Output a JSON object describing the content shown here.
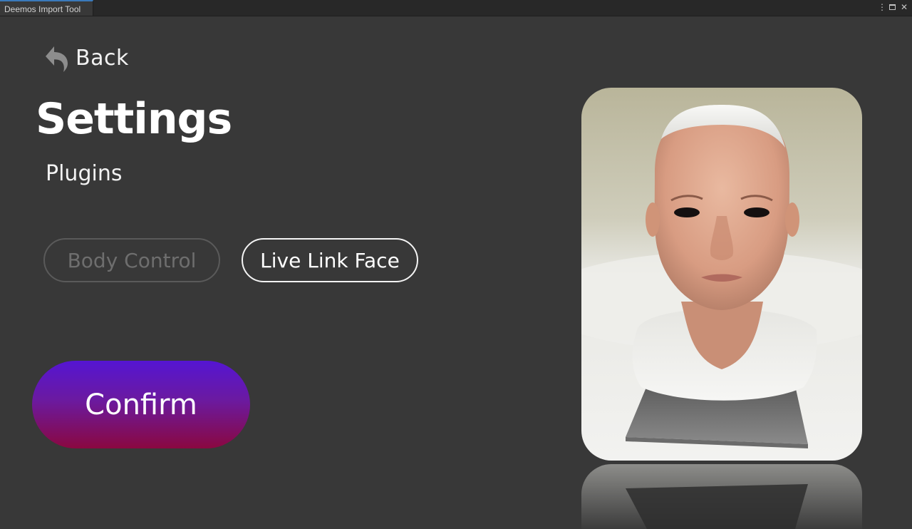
{
  "window": {
    "tab_title": "Deemos Import Tool",
    "controls": {
      "menu_glyph": "⋮",
      "close_glyph": "✕"
    }
  },
  "nav": {
    "back_label": "Back",
    "back_icon": "undo-arrow-icon"
  },
  "page": {
    "title": "Settings",
    "subtitle": "Plugins"
  },
  "plugins": [
    {
      "label": "Body Control",
      "state": "inactive"
    },
    {
      "label": "Live Link Face",
      "state": "active"
    }
  ],
  "actions": {
    "confirm_label": "Confirm"
  },
  "colors": {
    "background": "#383838",
    "confirm_gradient_top": "#5515d2",
    "confirm_gradient_bottom": "#8a0840",
    "tab_accent": "#3a79bb"
  }
}
